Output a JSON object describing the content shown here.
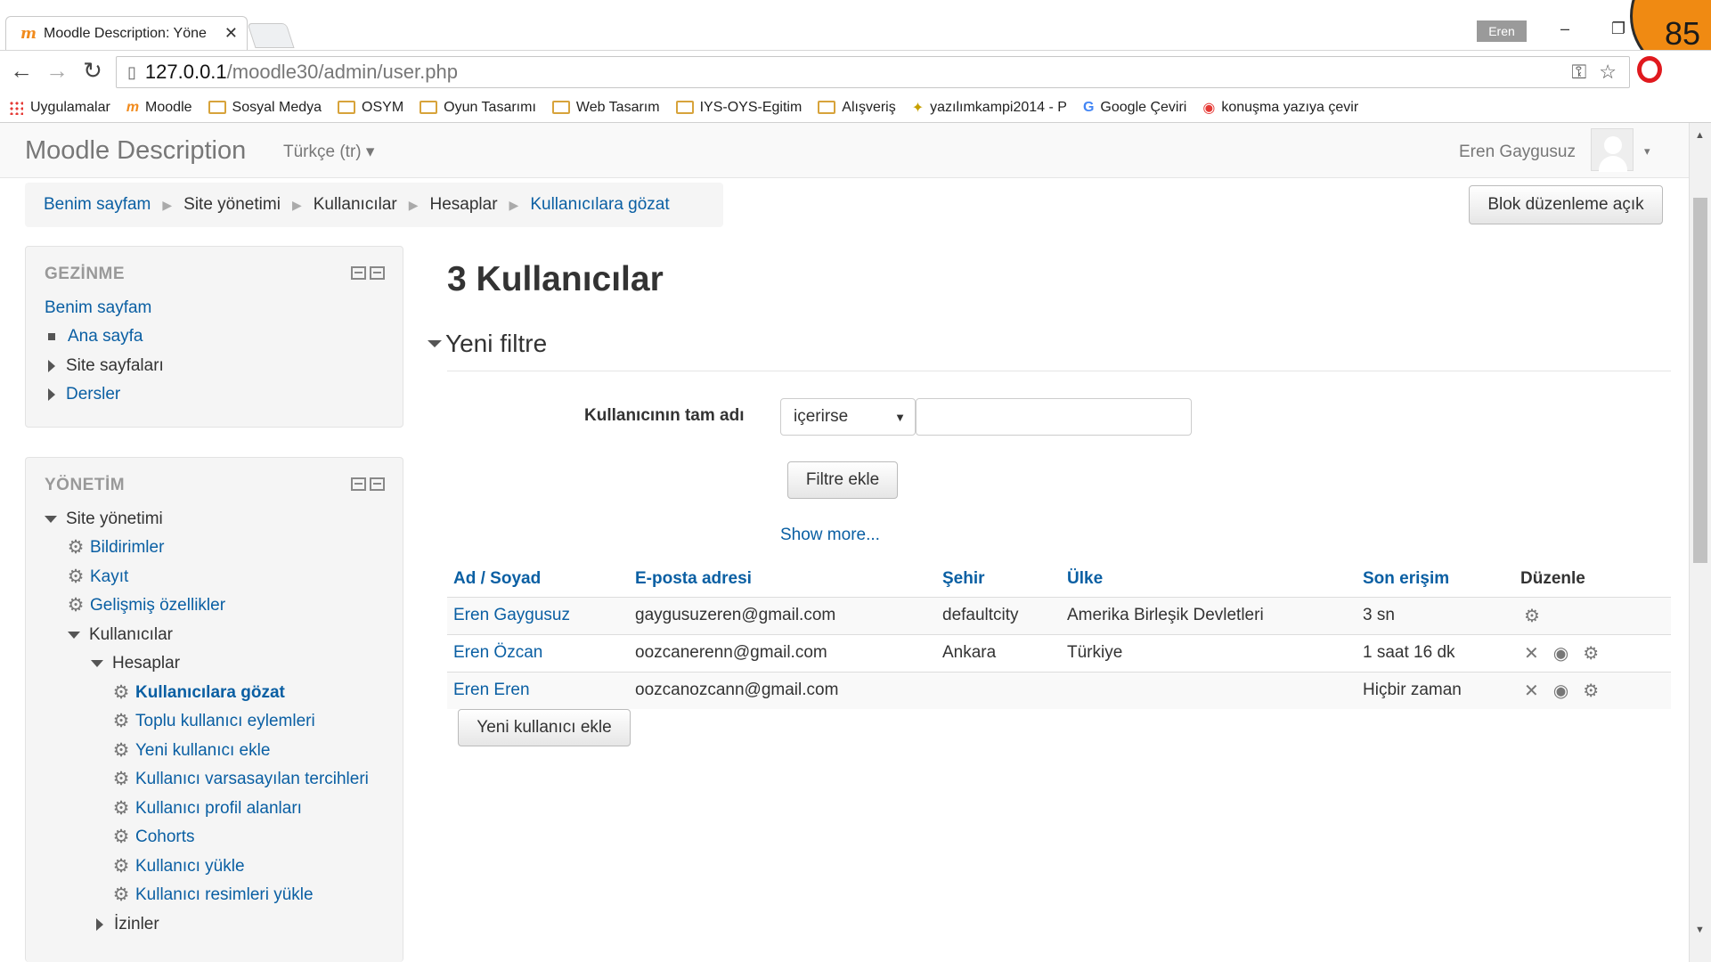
{
  "browser": {
    "tab_title": "Moodle Description: Yöne",
    "tab_favicon": "m",
    "tab_close": "✕",
    "user_chip": "Eren",
    "minimize": "–",
    "restore": "❐",
    "badge_number": "85",
    "back": "←",
    "forward": "→",
    "reload": "↻",
    "url_host": "127.0.0.1",
    "url_path": "/moodle30/admin/user.php"
  },
  "bookmarks": [
    {
      "label": "Uygulamalar",
      "type": "apps"
    },
    {
      "label": "Moodle",
      "type": "moodle"
    },
    {
      "label": "Sosyal Medya",
      "type": "folder"
    },
    {
      "label": "OSYM",
      "type": "folder"
    },
    {
      "label": "Oyun Tasarımı",
      "type": "folder"
    },
    {
      "label": "Web Tasarım",
      "type": "folder"
    },
    {
      "label": "IYS-OYS-Egitim",
      "type": "folder"
    },
    {
      "label": "Alışveriş",
      "type": "folder"
    },
    {
      "label": "yazılımkampi2014 - P",
      "type": "site"
    },
    {
      "label": "Google Çeviri",
      "type": "translate"
    },
    {
      "label": "konuşma yazıya çevir",
      "type": "chrome"
    }
  ],
  "navbar": {
    "brand": "Moodle Description",
    "language": "Türkçe (tr) ▾",
    "user_name": "Eren Gaygusuz",
    "caret": "▾"
  },
  "breadcrumb": {
    "items": [
      "Benim sayfam",
      "Site yönetimi",
      "Kullanıcılar",
      "Hesaplar",
      "Kullanıcılara gözat"
    ],
    "separator": "▶"
  },
  "edit_button": "Blok düzenleme açık",
  "navigation_block": {
    "title": "GEZİNME",
    "items": [
      "Benim sayfam",
      "Ana sayfa",
      "Site sayfaları",
      "Dersler"
    ]
  },
  "admin_block": {
    "title": "YÖNETİM",
    "items": [
      "Site yönetimi",
      "Bildirimler",
      "Kayıt",
      "Gelişmiş özellikler",
      "Kullanıcılar",
      "Hesaplar",
      "Kullanıcılara gözat",
      "Toplu kullanıcı eylemleri",
      "Yeni kullanıcı ekle",
      "Kullanıcı varsasayılan tercihleri",
      "Kullanıcı profil alanları",
      "Cohorts",
      "Kullanıcı yükle",
      "Kullanıcı resimleri yükle",
      "İzinler"
    ]
  },
  "main": {
    "title": "3 Kullanıcılar",
    "filter_legend": "Yeni filtre",
    "filter_label": "Kullanıcının tam adı",
    "filter_operator": "içerirse",
    "filter_value": "",
    "add_filter_button": "Filtre ekle",
    "show_more": "Show more...",
    "add_user_button": "Yeni kullanıcı ekle"
  },
  "table": {
    "headers": [
      "Ad / Soyad",
      "E-posta adresi",
      "Şehir",
      "Ülke",
      "Son erişim",
      "Düzenle"
    ],
    "rows": [
      {
        "name": "Eren Gaygusuz",
        "email": "gaygusuzeren@gmail.com",
        "city": "defaultcity",
        "country": "Amerika Birleşik Devletleri",
        "lastaccess": "3 sn",
        "actions": [
          "gear"
        ]
      },
      {
        "name": "Eren Özcan",
        "email": "oozcanerenn@gmail.com",
        "city": "Ankara",
        "country": "Türkiye",
        "lastaccess": "1 saat 16 dk",
        "actions": [
          "delete",
          "suspend",
          "gear"
        ]
      },
      {
        "name": "Eren Eren",
        "email": "oozcanozcann@gmail.com",
        "city": "",
        "country": "",
        "lastaccess": "Hiçbir zaman",
        "actions": [
          "delete",
          "suspend",
          "gear"
        ]
      }
    ]
  },
  "icons": {
    "gear": "⚙",
    "delete": "✕",
    "suspend": "◉"
  }
}
